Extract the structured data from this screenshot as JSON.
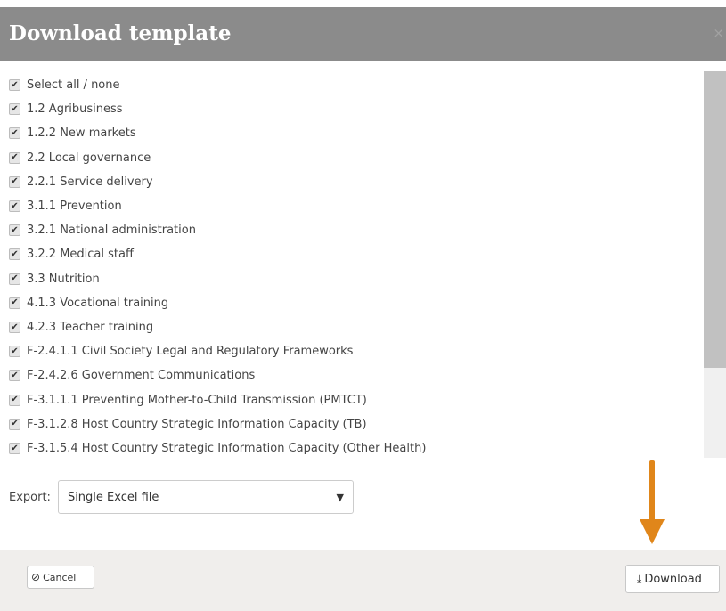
{
  "dialog": {
    "title": "Download template",
    "close_label": "×"
  },
  "items": [
    {
      "label": "Select all / none",
      "checked": true
    },
    {
      "label": "1.2 Agribusiness",
      "checked": true
    },
    {
      "label": "1.2.2 New markets",
      "checked": true
    },
    {
      "label": "2.2 Local governance",
      "checked": true
    },
    {
      "label": "2.2.1 Service delivery",
      "checked": true
    },
    {
      "label": "3.1.1 Prevention",
      "checked": true
    },
    {
      "label": "3.2.1 National administration",
      "checked": true
    },
    {
      "label": "3.2.2 Medical staff",
      "checked": true
    },
    {
      "label": "3.3 Nutrition",
      "checked": true
    },
    {
      "label": "4.1.3 Vocational training",
      "checked": true
    },
    {
      "label": "4.2.3 Teacher training",
      "checked": true
    },
    {
      "label": "F-2.4.1.1 Civil Society Legal and Regulatory Frameworks",
      "checked": true
    },
    {
      "label": "F-2.4.2.6 Government Communications",
      "checked": true
    },
    {
      "label": "F-3.1.1.1 Preventing Mother-to-Child Transmission (PMTCT)",
      "checked": true
    },
    {
      "label": "F-3.1.2.8 Host Country Strategic Information Capacity (TB)",
      "checked": true
    },
    {
      "label": "F-3.1.5.4 Host Country Strategic Information Capacity (Other Health)",
      "checked": true
    }
  ],
  "export": {
    "label": "Export:",
    "selected": "Single Excel file",
    "dropdown_glyph": "▼"
  },
  "footer": {
    "cancel_icon": "⊘",
    "cancel_label": "Cancel",
    "download_icon": "⤓",
    "download_label": "Download"
  },
  "colors": {
    "header_bg": "#8b8b8b",
    "footer_bg": "#f0eeec",
    "annotation_arrow": "#e0861a"
  }
}
